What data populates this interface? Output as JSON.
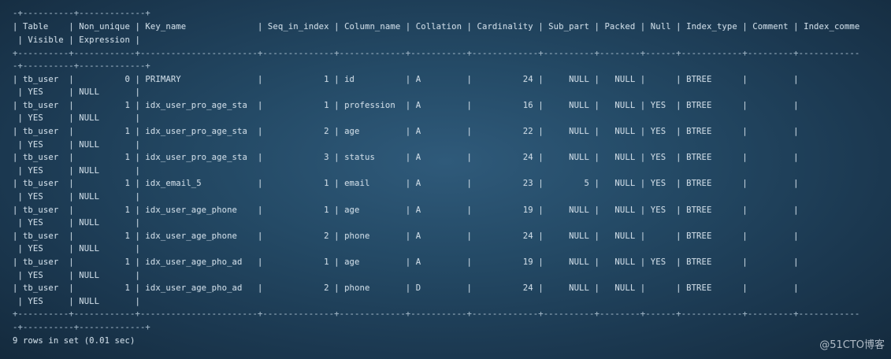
{
  "terminal": {
    "lines": [
      "-+----------+-------------+",
      "| Table    | Non_unique | Key_name              | Seq_in_index | Column_name | Collation | Cardinality | Sub_part | Packed | Null | Index_type | Comment | Index_comme",
      " | Visible | Expression |",
      "+----------+------------+-----------------------+--------------+-------------+-----------+-------------+----------+--------+------+------------+---------+------------",
      "-+----------+-------------+",
      "| tb_user  |          0 | PRIMARY               |            1 | id          | A         |          24 |     NULL |   NULL |      | BTREE      |         |",
      " | YES     | NULL       |",
      "| tb_user  |          1 | idx_user_pro_age_sta  |            1 | profession  | A         |          16 |     NULL |   NULL | YES  | BTREE      |         |",
      " | YES     | NULL       |",
      "| tb_user  |          1 | idx_user_pro_age_sta  |            2 | age         | A         |          22 |     NULL |   NULL | YES  | BTREE      |         |",
      " | YES     | NULL       |",
      "| tb_user  |          1 | idx_user_pro_age_sta  |            3 | status      | A         |          24 |     NULL |   NULL | YES  | BTREE      |         |",
      " | YES     | NULL       |",
      "| tb_user  |          1 | idx_email_5           |            1 | email       | A         |          23 |        5 |   NULL | YES  | BTREE      |         |",
      " | YES     | NULL       |",
      "| tb_user  |          1 | idx_user_age_phone    |            1 | age         | A         |          19 |     NULL |   NULL | YES  | BTREE      |         |",
      " | YES     | NULL       |",
      "| tb_user  |          1 | idx_user_age_phone    |            2 | phone       | A         |          24 |     NULL |   NULL |      | BTREE      |         |",
      " | YES     | NULL       |",
      "| tb_user  |          1 | idx_user_age_pho_ad   |            1 | age         | A         |          19 |     NULL |   NULL | YES  | BTREE      |         |",
      " | YES     | NULL       |",
      "| tb_user  |          1 | idx_user_age_pho_ad   |            2 | phone       | D         |          24 |     NULL |   NULL |      | BTREE      |         |",
      " | YES     | NULL       |",
      "+----------+------------+-----------------------+--------------+-------------+-----------+-------------+----------+--------+------+------------+---------+------------",
      "-+----------+-------------+",
      "9 rows in set (0.01 sec)"
    ]
  },
  "watermark": "@51CTO博客"
}
